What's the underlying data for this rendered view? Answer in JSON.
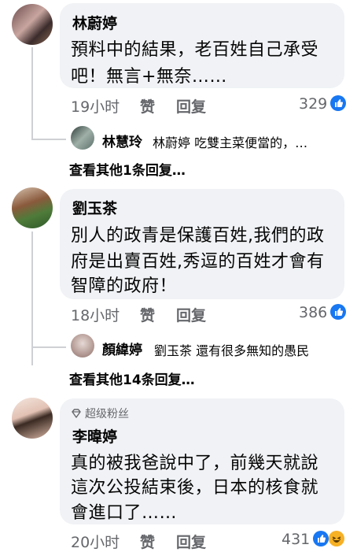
{
  "comments": [
    {
      "author": "林蔚婷",
      "lines": [
        "預料中的結果，老百姓自己承受",
        "吧！無言+無奈……"
      ],
      "time": "19小时",
      "like_label": "赞",
      "reply_label": "回复",
      "reaction_count": "329",
      "reply_preview": {
        "author": "林慧玲",
        "text": "林蔚婷 吃雙主菜便當的，…"
      },
      "more_replies": "查看其他1条回复…"
    },
    {
      "author": "劉玉茶",
      "lines": [
        "別人的政青是保護百姓,我們的政",
        "府是出賣百姓,秀逗的百姓才會有",
        "智障的政府！"
      ],
      "time": "18小时",
      "like_label": "赞",
      "reply_label": "回复",
      "reaction_count": "386",
      "reply_preview": {
        "author": "顏緯婷",
        "text": "劉玉茶 還有很多無知的愚民"
      },
      "more_replies": "查看其他14条回复…"
    },
    {
      "badge": "超级粉丝",
      "author": "李暐婷",
      "lines": [
        "真的被我爸說中了，前幾天就說",
        "這次公投結束後，日本的核食就",
        "會進口了……"
      ],
      "time": "20小时",
      "like_label": "赞",
      "reply_label": "回复",
      "reaction_count": "431"
    }
  ],
  "colors": {
    "bubble": "#f0f2f5",
    "like_blue": "#1877f2",
    "meta_gray": "#65676b",
    "haha_yellow": "#f7b125"
  }
}
